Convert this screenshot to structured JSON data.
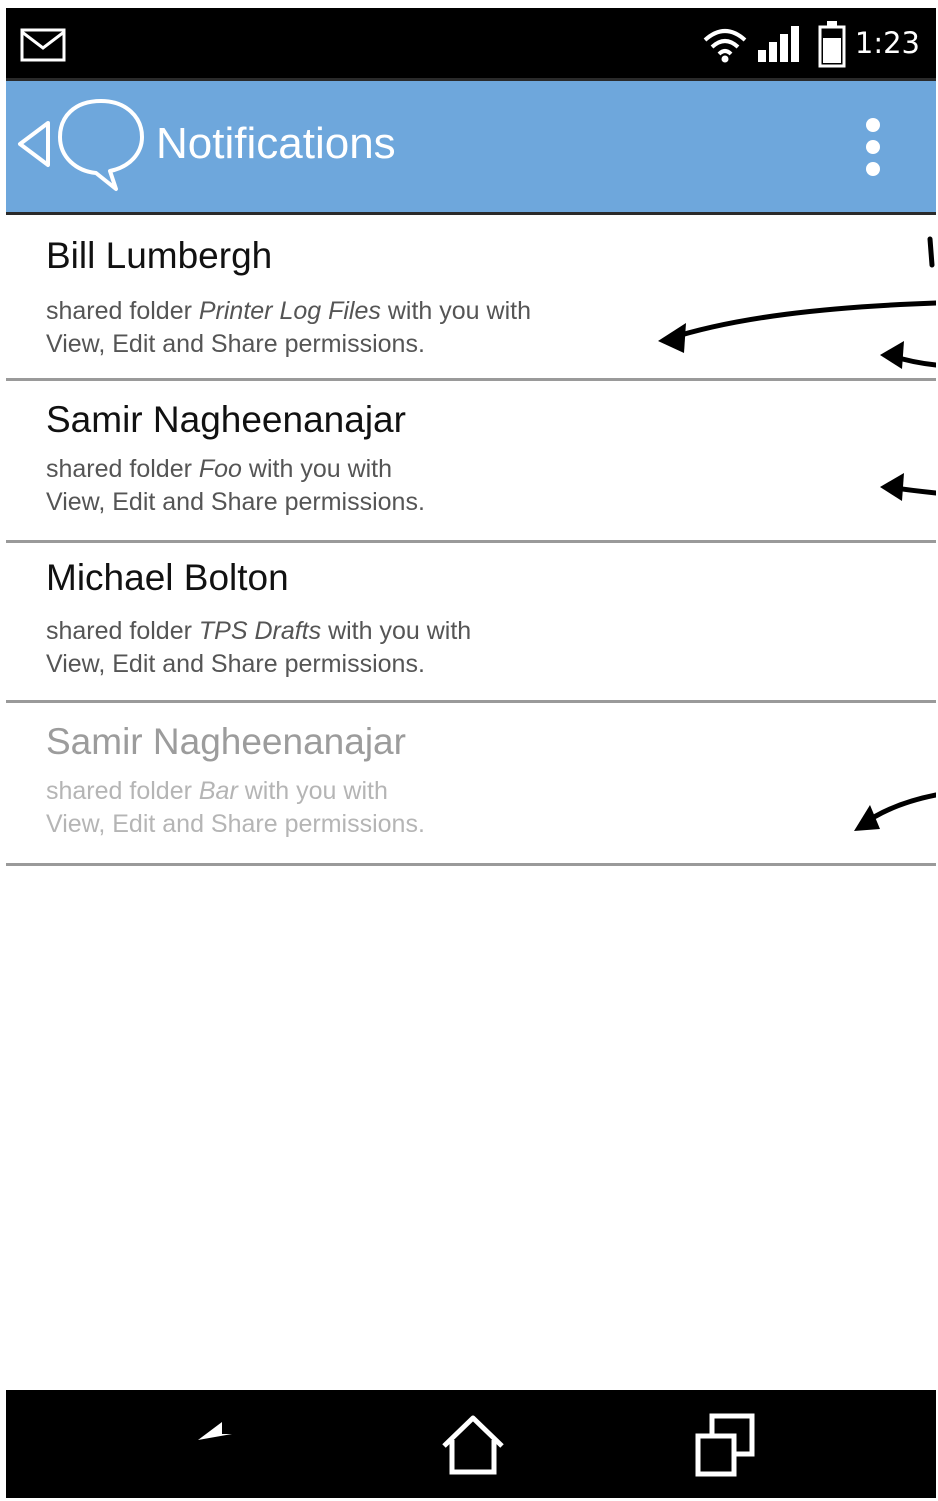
{
  "status": {
    "time": "1:23",
    "icons": [
      "mail-icon",
      "wifi-icon",
      "signal-icon",
      "battery-icon"
    ]
  },
  "appbar": {
    "title": "Notifications",
    "color": "#6ea7dc",
    "icons": [
      "back-chevron-icon",
      "speech-bubble-icon",
      "overflow-menu-icon"
    ]
  },
  "notifications": [
    {
      "name": "Bill Lumbergh",
      "prefix": "shared folder ",
      "folder": "Printer Log Files",
      "suffix": " with you with",
      "line2": "View, Edit and Share permissions.",
      "read": false
    },
    {
      "name": "Samir Nagheenanajar",
      "prefix": "shared folder ",
      "folder": "Foo",
      "suffix": " with you with",
      "line2": "View, Edit and Share permissions.",
      "read": false
    },
    {
      "name": "Michael Bolton",
      "prefix": "shared folder ",
      "folder": "TPS Drafts",
      "suffix": " with you with",
      "line2": "View, Edit and Share permissions.",
      "read": false
    },
    {
      "name": "Samir Nagheenanajar",
      "prefix": "shared folder ",
      "folder": "Bar",
      "suffix": " with you with",
      "line2": "View, Edit and Share permissions.",
      "read": true
    }
  ],
  "navbar": {
    "icons": [
      "back-arrow-icon",
      "home-icon",
      "recent-apps-icon"
    ]
  }
}
